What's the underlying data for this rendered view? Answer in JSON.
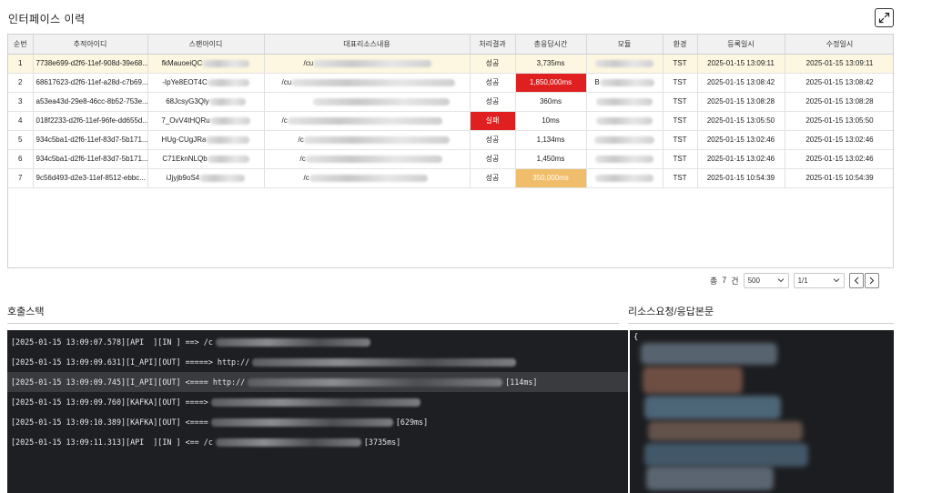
{
  "page": {
    "title": "인터페이스 이력"
  },
  "table": {
    "headers": [
      "순번",
      "추적아이디",
      "스팬아이디",
      "대표리소스내용",
      "처리결과",
      "총응답시간",
      "모듈",
      "환경",
      "등록일시",
      "수정일시"
    ],
    "rows": [
      {
        "seq": "1",
        "trace": "7738e699-d2f6-11ef-908d-39e68...",
        "span": "fkMauoeiQC",
        "resource": "/cu",
        "result": "성공",
        "time": "3,735ms",
        "module": "",
        "env": "TST",
        "created": "2025-01-15 13:09:11",
        "updated": "2025-01-15 13:09:11"
      },
      {
        "seq": "2",
        "trace": "68617623-d2f6-11ef-a28d-c7b69...",
        "span": "-IpYe8EOT4C",
        "resource": "/cu",
        "result": "성공",
        "time": "1,850,000ms",
        "module": "B",
        "env": "TST",
        "created": "2025-01-15 13:08:42",
        "updated": "2025-01-15 13:08:42"
      },
      {
        "seq": "3",
        "trace": "a53ea43d-29e8-46cc-8b52-753e...",
        "span": "68JcsyG3Qly",
        "resource": "",
        "result": "성공",
        "time": "360ms",
        "module": "",
        "env": "TST",
        "created": "2025-01-15 13:08:28",
        "updated": "2025-01-15 13:08:28"
      },
      {
        "seq": "4",
        "trace": "018f2233-d2f6-11ef-96fe-dd655d...",
        "span": "7_OvV4tHQRu",
        "resource": "/c",
        "result": "실패",
        "time": "10ms",
        "module": "",
        "env": "TST",
        "created": "2025-01-15 13:05:50",
        "updated": "2025-01-15 13:05:50"
      },
      {
        "seq": "5",
        "trace": "934c5ba1-d2f6-11ef-83d7-5b171...",
        "span": "HUg-CUgJRa",
        "resource": "/c",
        "result": "성공",
        "time": "1,134ms",
        "module": "",
        "env": "TST",
        "created": "2025-01-15 13:02:46",
        "updated": "2025-01-15 13:02:46"
      },
      {
        "seq": "6",
        "trace": "934c5ba1-d2f6-11ef-83d7-5b171...",
        "span": "C71EknNLQb",
        "resource": "/c",
        "result": "성공",
        "time": "1,450ms",
        "module": "",
        "env": "TST",
        "created": "2025-01-15 13:02:46",
        "updated": "2025-01-15 13:02:46"
      },
      {
        "seq": "7",
        "trace": "9c56d493-d2e3-11ef-8512-ebbc...",
        "span": "iJjyjb9oS4",
        "resource": "/c",
        "result": "성공",
        "time": "350,000ms",
        "module": "",
        "env": "TST",
        "created": "2025-01-15 10:54:39",
        "updated": "2025-01-15 10:54:39"
      }
    ]
  },
  "pager": {
    "total_prefix": "총",
    "total_count": "7",
    "total_suffix": "건",
    "page_size": "500",
    "page": "1/1"
  },
  "sections": {
    "stack_title": "호출스택",
    "resp_title": "리소스요청/응답본문"
  },
  "stack": {
    "lines": [
      {
        "head": "[2025-01-15 13:09:07.578][API  ][IN ] ==> /c",
        "tail": ""
      },
      {
        "head": "[2025-01-15 13:09:09.631][I_API][OUT] =====> http://",
        "tail": ""
      },
      {
        "head": "[2025-01-15 13:09:09.745][I_API][OUT] <==== http://",
        "tail": "[114ms]"
      },
      {
        "head": "[2025-01-15 13:09:09.760][KAFKA][OUT] ====>",
        "tail": ""
      },
      {
        "head": "[2025-01-15 13:09:10.389][KAFKA][OUT] <====",
        "tail": "[629ms]"
      },
      {
        "head": "[2025-01-15 13:09:11.313][API  ][IN ] <== /c",
        "tail": "[3735ms]"
      }
    ]
  },
  "resp": {
    "open_brace": "{"
  },
  "colors": {
    "error": "#e02020",
    "warning": "#f0bd6a",
    "selected_row": "#fdf6e1",
    "console_bg": "#1e1f22"
  },
  "icons": {
    "expand": "expand-icon",
    "chevron": "chevron-down-icon",
    "prev": "chevron-left-icon",
    "next": "chevron-right-icon"
  }
}
